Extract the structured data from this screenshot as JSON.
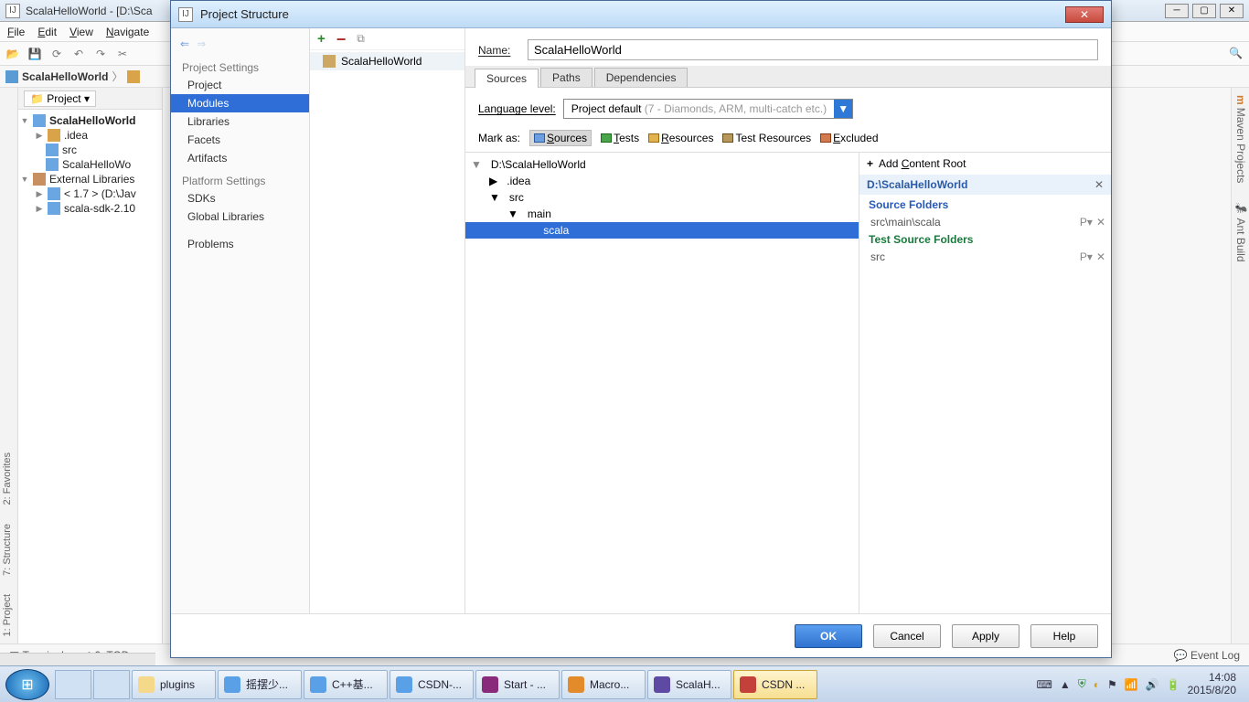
{
  "ide": {
    "title": "ScalaHelloWorld - [D:\\Sca",
    "menus": [
      "File",
      "Edit",
      "View",
      "Navigate"
    ],
    "breadcrumb": "ScalaHelloWorld",
    "project_panel": {
      "header": "Project",
      "root": "ScalaHelloWorld",
      "idea": ".idea",
      "src": "src",
      "module": "ScalaHelloWo",
      "ext_lib": "External Libraries",
      "jdk": "< 1.7 > (D:\\Jav",
      "sdk": "scala-sdk-2.10"
    },
    "left_tabs": [
      "1: Project",
      "7: Structure",
      "2: Favorites"
    ],
    "right_tabs": [
      "Maven Projects",
      "Ant Build"
    ],
    "status": {
      "terminal": "Terminal",
      "todo": "6: TOD",
      "eventlog": "Event Log"
    }
  },
  "dialog": {
    "title": "Project Structure",
    "settings_head1": "Project Settings",
    "settings_head2": "Platform Settings",
    "items1": [
      "Project",
      "Modules",
      "Libraries",
      "Facets",
      "Artifacts"
    ],
    "items2": [
      "SDKs",
      "Global Libraries"
    ],
    "problems": "Problems",
    "module_name": "ScalaHelloWorld",
    "name_label": "Name:",
    "name_value": "ScalaHelloWorld",
    "tabs": [
      "Sources",
      "Paths",
      "Dependencies"
    ],
    "lang_label": "Language level:",
    "lang_value": "Project default ",
    "lang_hint": "(7 - Diamonds, ARM, multi-catch etc.)",
    "mark_label": "Mark as:",
    "mark": {
      "src": "Sources",
      "tst": "Tests",
      "res": "Resources",
      "tres": "Test Resources",
      "exc": "Excluded"
    },
    "tree": {
      "root": "D:\\ScalaHelloWorld",
      "idea": ".idea",
      "src": "src",
      "main": "main",
      "scala": "scala"
    },
    "content_root": {
      "add": "Add Content Root",
      "root": "D:\\ScalaHelloWorld",
      "src_hd": "Source Folders",
      "src_item": "src\\main\\scala",
      "tst_hd": "Test Source Folders",
      "tst_item": "src"
    },
    "buttons": {
      "ok": "OK",
      "cancel": "Cancel",
      "apply": "Apply",
      "help": "Help"
    }
  },
  "taskbar": {
    "items": [
      {
        "label": "plugins",
        "cls": "fold"
      },
      {
        "label": "摇摆少...",
        "cls": "ie"
      },
      {
        "label": "C++基...",
        "cls": "ie"
      },
      {
        "label": "CSDN-...",
        "cls": "ie"
      },
      {
        "label": "Start - ...",
        "cls": "pdf"
      },
      {
        "label": "Macro...",
        "cls": "mac"
      },
      {
        "label": "ScalaH...",
        "cls": "ij"
      },
      {
        "label": "CSDN ...",
        "cls": "active"
      }
    ],
    "time": "14:08",
    "date": "2015/8/20"
  }
}
